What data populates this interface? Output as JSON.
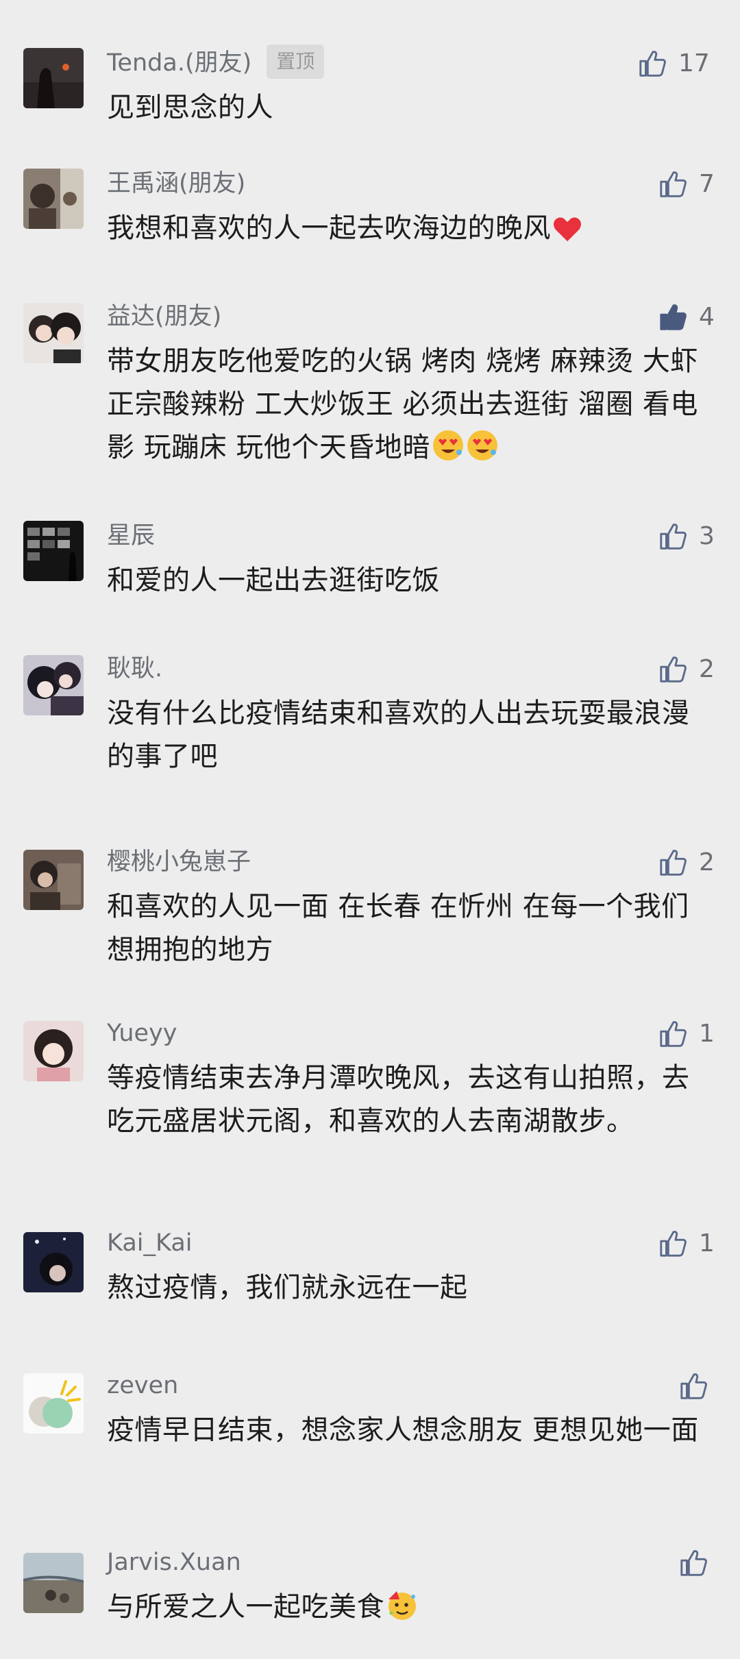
{
  "colors": {
    "background": "#ededed",
    "name_text": "#6b6f75",
    "body_text": "#1c1c1c",
    "like_icon_outline": "#5a6a8a",
    "like_icon_active": "#4a5a7f"
  },
  "comments": [
    {
      "name": "Tenda.(朋友)",
      "badge": "置顶",
      "text": "见到思念的人",
      "likes": "17",
      "liked": false
    },
    {
      "name": "王禹涵(朋友)",
      "text": "我想和喜欢的人一起去吹海边的晚风",
      "emoji": "heart",
      "likes": "7",
      "liked": false
    },
    {
      "name": "益达(朋友)",
      "text": "带女朋友吃他爱吃的火锅 烤肉 烧烤 麻辣烫 大虾 正宗酸辣粉 工大炒饭王 必须出去逛街 溜圈  看电影 玩蹦床 玩他个天昏地暗",
      "emoji": "heart-eyes",
      "emoji_count": 2,
      "likes": "4",
      "liked": true
    },
    {
      "name": "星辰",
      "text": "和爱的人一起出去逛街吃饭",
      "likes": "3",
      "liked": false
    },
    {
      "name": "耿耿.",
      "text": "没有什么比疫情结束和喜欢的人出去玩耍最浪漫的事了吧",
      "likes": "2",
      "liked": false
    },
    {
      "name": "樱桃小兔崽子",
      "text": "和喜欢的人见一面 在长春 在忻州 在每一个我们想拥抱的地方",
      "likes": "2",
      "liked": false
    },
    {
      "name": "Yueyy",
      "text": "等疫情结束去净月潭吹晚风，去这有山拍照，去吃元盛居状元阁，和喜欢的人去南湖散步。",
      "likes": "1",
      "liked": false
    },
    {
      "name": "Kai_Kai",
      "text": "熬过疫情，我们就永远在一起",
      "likes": "1",
      "liked": false
    },
    {
      "name": "zeven",
      "text": "疫情早日结束，想念家人想念朋友 更想见她一面",
      "likes": "",
      "liked": false
    },
    {
      "name": "Jarvis.Xuan",
      "text": "与所爱之人一起吃美食",
      "emoji": "party-face",
      "likes": "",
      "liked": false
    }
  ]
}
